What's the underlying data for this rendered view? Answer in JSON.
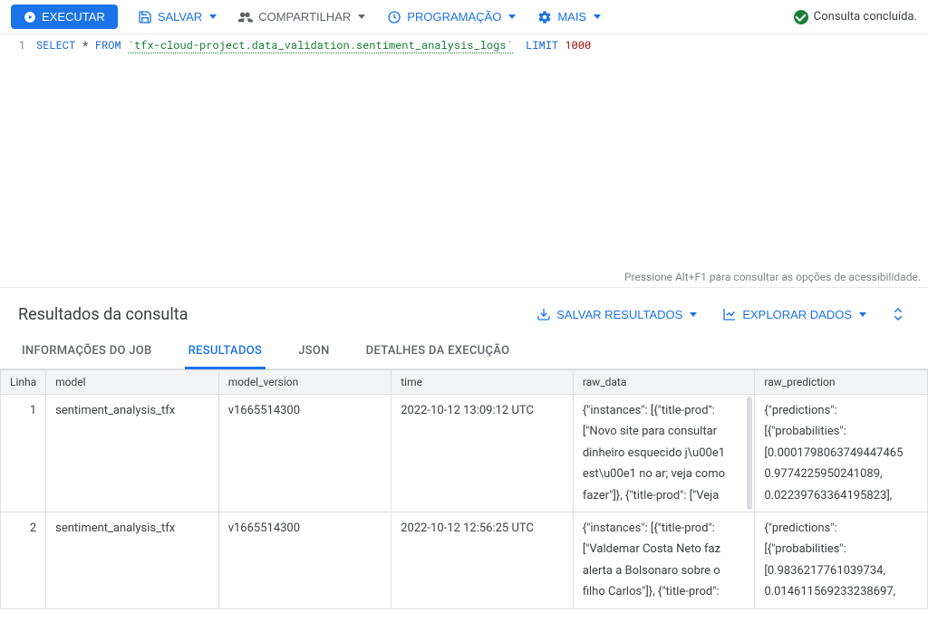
{
  "toolbar": {
    "run": "EXECUTAR",
    "save": "SALVAR",
    "share": "COMPARTILHAR",
    "schedule": "PROGRAMAÇÃO",
    "more": "MAIS"
  },
  "status": "Consulta concluída.",
  "editor": {
    "line_number": "1",
    "sql": {
      "select": "SELECT",
      "star": " * ",
      "from": "FROM",
      "table": "`tfx-cloud-project.data_validation.sentiment_analysis_logs`",
      "limit": "LIMIT",
      "num": "1000"
    },
    "footer": "Pressione Alt+F1 para consultar as opções de acessibilidade."
  },
  "results": {
    "title": "Resultados da consulta",
    "save_results": "SALVAR RESULTADOS",
    "explore_data": "EXPLORAR DADOS",
    "tabs": {
      "job_info": "INFORMAÇÕES DO JOB",
      "results": "RESULTADOS",
      "json": "JSON",
      "exec_details": "DETALHES DA EXECUÇÃO"
    },
    "columns": {
      "line": "Linha",
      "model": "model",
      "model_version": "model_version",
      "time": "time",
      "raw_data": "raw_data",
      "raw_prediction": "raw_prediction"
    },
    "rows": [
      {
        "line": "1",
        "model": "sentiment_analysis_tfx",
        "model_version": "v1665514300",
        "time": "2022-10-12 13:09:12 UTC",
        "raw_data": "{\"instances\": [{\"title-prod\": [\"Novo site para consultar dinheiro esquecido j\\u00e1 est\\u00e1 no ar; veja como fazer\"]}, {\"title-prod\": [\"Veja",
        "raw_prediction": "{\"predictions\": [{\"probabilities\": [0.0001798063749447465 0.9774225950241089, 0.02239763364195823],"
      },
      {
        "line": "2",
        "model": "sentiment_analysis_tfx",
        "model_version": "v1665514300",
        "time": "2022-10-12 12:56:25 UTC",
        "raw_data": "{\"instances\": [{\"title-prod\": [\"Valdemar Costa Neto faz alerta a Bolsonaro sobre o filho Carlos\"]}, {\"title-prod\":",
        "raw_prediction": "{\"predictions\": [{\"probabilities\": [0.9836217761039734, 0.014611569233238697,"
      }
    ]
  }
}
